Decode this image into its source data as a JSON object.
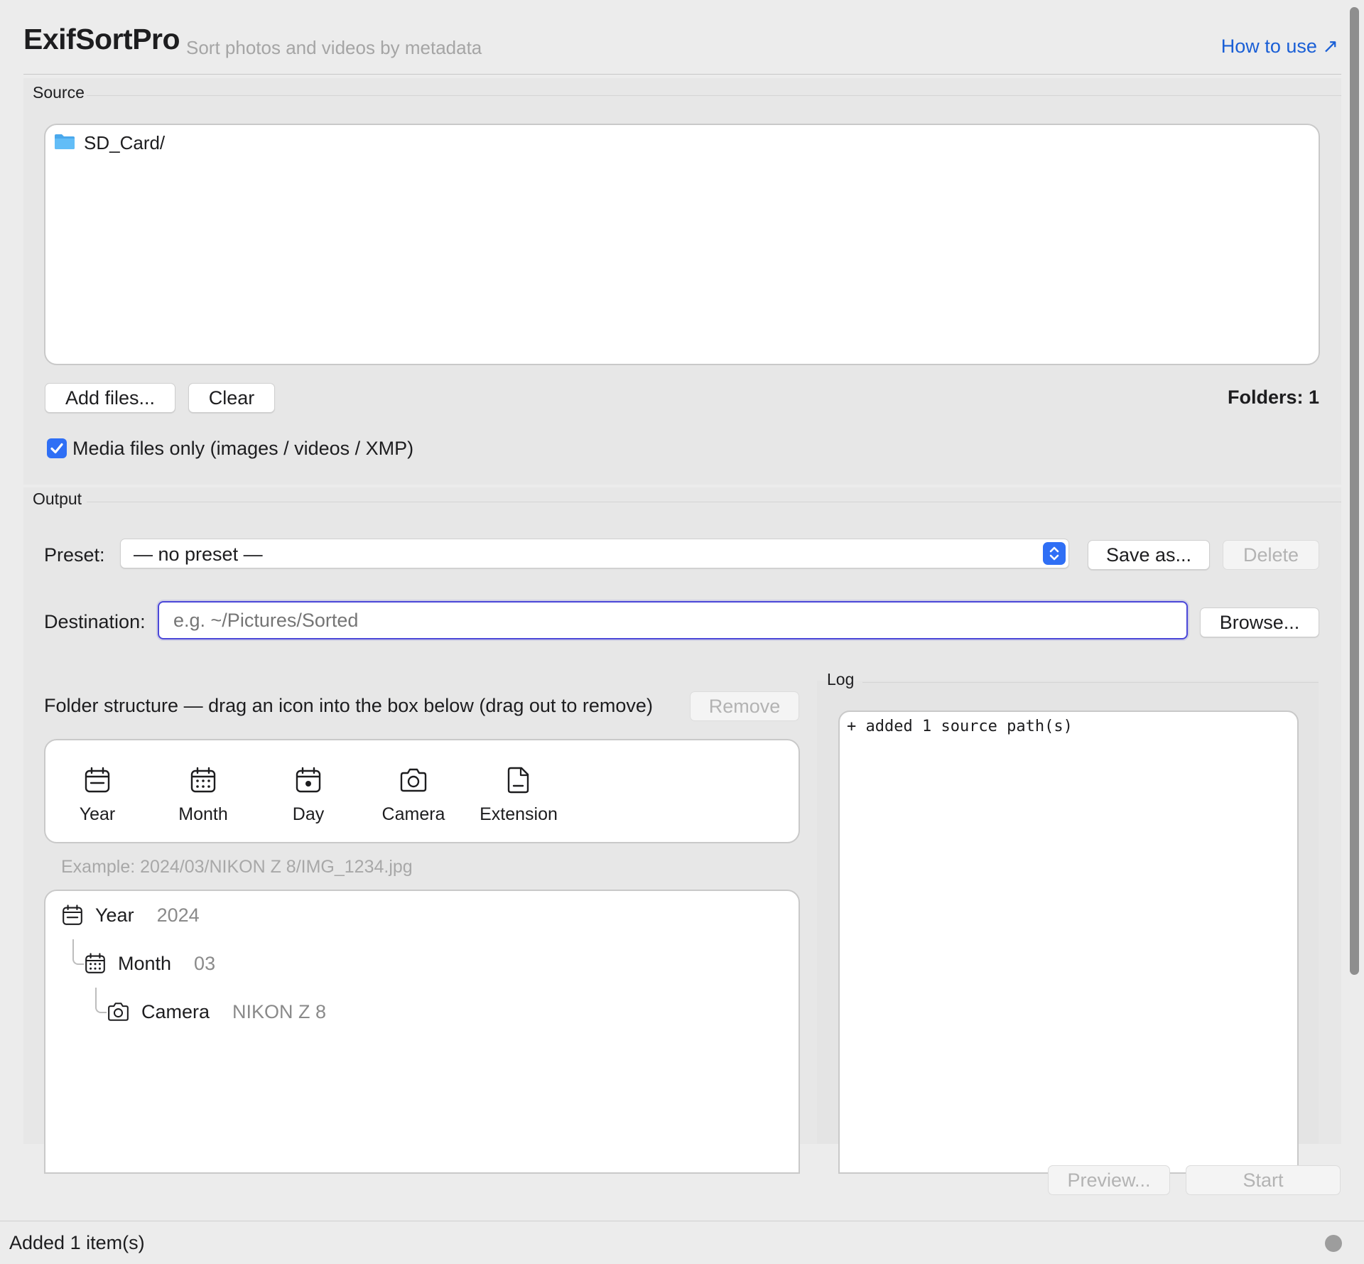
{
  "header": {
    "app_title": "ExifSortPro",
    "subtitle": "Sort photos and videos by metadata",
    "help_link": "How to use ↗"
  },
  "source": {
    "section_label": "Source",
    "items": [
      {
        "icon": "folder-icon",
        "name": "SD_Card/"
      }
    ],
    "add_files_label": "Add files...",
    "clear_label": "Clear",
    "folders_count": "Folders: 1",
    "media_only_checked": true,
    "media_only_label": "Media files only (images / videos / XMP)"
  },
  "output": {
    "section_label": "Output",
    "preset_label": "Preset:",
    "preset_value": "— no preset —",
    "save_as_label": "Save as...",
    "delete_label": "Delete",
    "destination_label": "Destination:",
    "destination_value": "",
    "destination_placeholder": "e.g. ~/Pictures/Sorted",
    "browse_label": "Browse...",
    "folder_structure_label": "Folder structure — drag an icon into the box below (drag out to remove)",
    "remove_label": "Remove",
    "palette": [
      {
        "label": "Year",
        "icon": "calendar-icon"
      },
      {
        "label": "Month",
        "icon": "calendar-grid-icon"
      },
      {
        "label": "Day",
        "icon": "calendar-day-icon"
      },
      {
        "label": "Camera",
        "icon": "camera-icon"
      },
      {
        "label": "Extension",
        "icon": "document-icon"
      }
    ],
    "example_text": "Example: 2024/03/NIKON Z 8/IMG_1234.jpg",
    "structure": [
      {
        "label": "Year",
        "value": "2024",
        "icon": "calendar-icon"
      },
      {
        "label": "Month",
        "value": "03",
        "icon": "calendar-grid-icon"
      },
      {
        "label": "Camera",
        "value": "NIKON Z 8",
        "icon": "camera-icon"
      }
    ]
  },
  "log": {
    "section_label": "Log",
    "lines": [
      "+ added 1 source path(s)"
    ]
  },
  "actions": {
    "preview_label": "Preview...",
    "start_label": "Start"
  },
  "status": {
    "text": "Added 1 item(s)"
  },
  "colors": {
    "accent": "#2f6ff5",
    "link": "#1a5fd6",
    "focus_ring": "#4b47d8"
  }
}
